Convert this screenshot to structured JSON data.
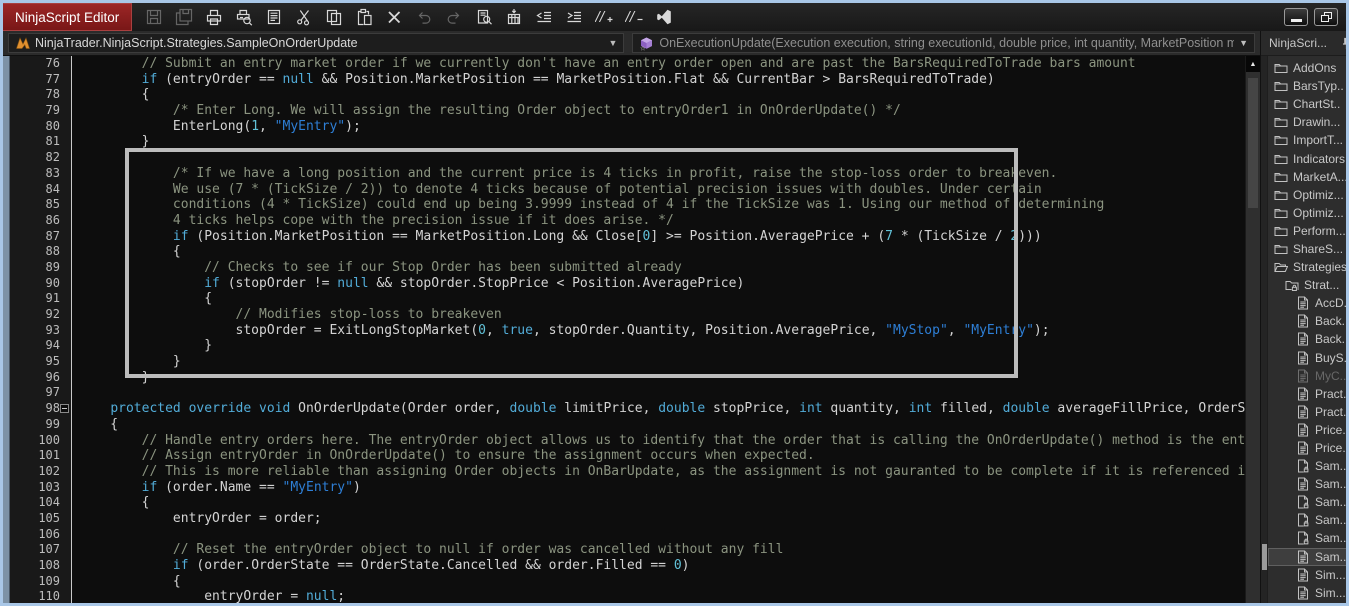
{
  "window": {
    "title": "NinjaScript Editor",
    "controls": [
      {
        "name": "minimize"
      },
      {
        "name": "restore"
      }
    ]
  },
  "colors": {
    "window_border": "#A9C7E7",
    "title_tab_red": "#8E2020",
    "editor_background": "#0D0D0D",
    "gutter_background": "#191919",
    "panel_background": "#2D2D2D",
    "keyword": "#52ACD8",
    "string": "#2E7FD6",
    "number": "#62C2D8",
    "comment": "#8B9480",
    "plain_code": "#D4D4D4",
    "highlight_box_border": "#BCBCBC"
  },
  "toolbar": {
    "buttons": [
      {
        "name": "save",
        "icon": "save",
        "disabled": true
      },
      {
        "name": "save-all",
        "icon": "save-all",
        "disabled": true
      },
      {
        "name": "print",
        "icon": "print",
        "disabled": false
      },
      {
        "name": "print-preview",
        "icon": "print-preview",
        "disabled": false
      },
      {
        "name": "page-setup",
        "icon": "page-setup",
        "disabled": false
      },
      {
        "name": "cut",
        "icon": "cut",
        "disabled": false
      },
      {
        "name": "copy",
        "icon": "copy",
        "disabled": false
      },
      {
        "name": "paste",
        "icon": "paste",
        "disabled": false
      },
      {
        "name": "delete",
        "icon": "delete",
        "disabled": false
      },
      {
        "name": "undo",
        "icon": "undo",
        "disabled": true
      },
      {
        "name": "redo",
        "icon": "redo",
        "disabled": true
      },
      {
        "name": "find",
        "icon": "find",
        "disabled": false
      },
      {
        "name": "compile",
        "icon": "compile",
        "disabled": false
      },
      {
        "name": "unindent",
        "icon": "unindent",
        "disabled": false
      },
      {
        "name": "indent",
        "icon": "indent",
        "disabled": false
      },
      {
        "name": "comment-selection",
        "icon": "comment",
        "disabled": false
      },
      {
        "name": "uncomment-selection",
        "icon": "uncomment",
        "disabled": false
      },
      {
        "name": "edit-in-visual-studio",
        "icon": "visual-studio",
        "disabled": false
      }
    ]
  },
  "combos": {
    "class_selector": {
      "icon": "ninjatrader-logo",
      "value": "NinjaTrader.NinjaScript.Strategies.SampleOnOrderUpdate"
    },
    "method_selector": {
      "icon": "method-cube",
      "value": "OnExecutionUpdate(Execution execution, string executionId, double price, int quantity, MarketPosition m..."
    }
  },
  "editor": {
    "highlight_box": {
      "from_line": 82,
      "to_line": 96
    },
    "lines": [
      {
        "n": 76,
        "tokens": [
          [
            "c",
            "        // Submit an entry market order if we currently don't have an entry order open and are past the BarsRequiredToTrade bars amount"
          ]
        ]
      },
      {
        "n": 77,
        "tokens": [
          [
            "p",
            "        "
          ],
          [
            "k",
            "if"
          ],
          [
            "p",
            " (entryOrder == "
          ],
          [
            "k",
            "null"
          ],
          [
            "p",
            " && Position.MarketPosition == MarketPosition.Flat && CurrentBar > BarsRequiredToTrade)"
          ]
        ]
      },
      {
        "n": 78,
        "tokens": [
          [
            "p",
            "        {"
          ]
        ]
      },
      {
        "n": 79,
        "tokens": [
          [
            "c",
            "            /* Enter Long. We will assign the resulting Order object to entryOrder1 in OnOrderUpdate() */"
          ]
        ]
      },
      {
        "n": 80,
        "tokens": [
          [
            "p",
            "            EnterLong("
          ],
          [
            "n",
            "1"
          ],
          [
            "p",
            ", "
          ],
          [
            "s",
            "\"MyEntry\""
          ],
          [
            "p",
            ");"
          ]
        ]
      },
      {
        "n": 81,
        "tokens": [
          [
            "p",
            "        }"
          ]
        ]
      },
      {
        "n": 82,
        "tokens": []
      },
      {
        "n": 83,
        "tokens": [
          [
            "c",
            "            /* If we have a long position and the current price is 4 ticks in profit, raise the stop-loss order to breakeven."
          ]
        ]
      },
      {
        "n": 84,
        "tokens": [
          [
            "c",
            "            We use (7 * (TickSize / 2)) to denote 4 ticks because of potential precision issues with doubles. Under certain"
          ]
        ]
      },
      {
        "n": 85,
        "tokens": [
          [
            "c",
            "            conditions (4 * TickSize) could end up being 3.9999 instead of 4 if the TickSize was 1. Using our method of determining"
          ]
        ]
      },
      {
        "n": 86,
        "tokens": [
          [
            "c",
            "            4 ticks helps cope with the precision issue if it does arise. */"
          ]
        ]
      },
      {
        "n": 87,
        "tokens": [
          [
            "p",
            "            "
          ],
          [
            "k",
            "if"
          ],
          [
            "p",
            " (Position.MarketPosition == MarketPosition.Long && Close["
          ],
          [
            "n",
            "0"
          ],
          [
            "p",
            "] >= Position.AveragePrice + ("
          ],
          [
            "n",
            "7"
          ],
          [
            "p",
            " * (TickSize / "
          ],
          [
            "n",
            "2"
          ],
          [
            "p",
            ")))"
          ]
        ]
      },
      {
        "n": 88,
        "tokens": [
          [
            "p",
            "            {"
          ]
        ]
      },
      {
        "n": 89,
        "tokens": [
          [
            "c",
            "                // Checks to see if our Stop Order has been submitted already"
          ]
        ]
      },
      {
        "n": 90,
        "tokens": [
          [
            "p",
            "                "
          ],
          [
            "k",
            "if"
          ],
          [
            "p",
            " (stopOrder != "
          ],
          [
            "k",
            "null"
          ],
          [
            "p",
            " && stopOrder.StopPrice < Position.AveragePrice)"
          ]
        ]
      },
      {
        "n": 91,
        "tokens": [
          [
            "p",
            "                {"
          ]
        ]
      },
      {
        "n": 92,
        "tokens": [
          [
            "c",
            "                    // Modifies stop-loss to breakeven"
          ]
        ]
      },
      {
        "n": 93,
        "tokens": [
          [
            "p",
            "                    stopOrder = ExitLongStopMarket("
          ],
          [
            "n",
            "0"
          ],
          [
            "p",
            ", "
          ],
          [
            "k",
            "true"
          ],
          [
            "p",
            ", stopOrder.Quantity, Position.AveragePrice, "
          ],
          [
            "s",
            "\"MyStop\""
          ],
          [
            "p",
            ", "
          ],
          [
            "s",
            "\"MyEntry\""
          ],
          [
            "p",
            ");"
          ]
        ]
      },
      {
        "n": 94,
        "tokens": [
          [
            "p",
            "                }"
          ]
        ]
      },
      {
        "n": 95,
        "tokens": [
          [
            "p",
            "            }"
          ]
        ]
      },
      {
        "n": 96,
        "tokens": [
          [
            "p",
            "        }"
          ]
        ]
      },
      {
        "n": 97,
        "tokens": []
      },
      {
        "n": 98,
        "fold": "collapse",
        "tokens": [
          [
            "p",
            "    "
          ],
          [
            "k",
            "protected"
          ],
          [
            "p",
            " "
          ],
          [
            "k",
            "override"
          ],
          [
            "p",
            " "
          ],
          [
            "k",
            "void"
          ],
          [
            "p",
            " OnOrderUpdate(Order order, "
          ],
          [
            "k",
            "double"
          ],
          [
            "p",
            " limitPrice, "
          ],
          [
            "k",
            "double"
          ],
          [
            "p",
            " stopPrice, "
          ],
          [
            "k",
            "int"
          ],
          [
            "p",
            " quantity, "
          ],
          [
            "k",
            "int"
          ],
          [
            "p",
            " filled, "
          ],
          [
            "k",
            "double"
          ],
          [
            "p",
            " averageFillPrice, OrderState orderSta"
          ]
        ]
      },
      {
        "n": 99,
        "tokens": [
          [
            "p",
            "    {"
          ]
        ]
      },
      {
        "n": 100,
        "tokens": [
          [
            "c",
            "        // Handle entry orders here. The entryOrder object allows us to identify that the order that is calling the OnOrderUpdate() method is the entry order."
          ]
        ]
      },
      {
        "n": 101,
        "tokens": [
          [
            "c",
            "        // Assign entryOrder in OnOrderUpdate() to ensure the assignment occurs when expected."
          ]
        ]
      },
      {
        "n": 102,
        "tokens": [
          [
            "c",
            "        // This is more reliable than assigning Order objects in OnBarUpdate, as the assignment is not gauranted to be complete if it is referenced immediately a"
          ]
        ]
      },
      {
        "n": 103,
        "tokens": [
          [
            "p",
            "        "
          ],
          [
            "k",
            "if"
          ],
          [
            "p",
            " (order.Name == "
          ],
          [
            "s",
            "\"MyEntry\""
          ],
          [
            "p",
            ")"
          ]
        ]
      },
      {
        "n": 104,
        "tokens": [
          [
            "p",
            "        {"
          ]
        ]
      },
      {
        "n": 105,
        "tokens": [
          [
            "p",
            "            entryOrder = order;"
          ]
        ]
      },
      {
        "n": 106,
        "tokens": []
      },
      {
        "n": 107,
        "tokens": [
          [
            "c",
            "            // Reset the entryOrder object to null if order was cancelled without any fill"
          ]
        ]
      },
      {
        "n": 108,
        "tokens": [
          [
            "p",
            "            "
          ],
          [
            "k",
            "if"
          ],
          [
            "p",
            " (order.OrderState == OrderState.Cancelled && order.Filled == "
          ],
          [
            "n",
            "0"
          ],
          [
            "p",
            ")"
          ]
        ]
      },
      {
        "n": 109,
        "tokens": [
          [
            "p",
            "            {"
          ]
        ]
      },
      {
        "n": 110,
        "tokens": [
          [
            "p",
            "                entryOrder = "
          ],
          [
            "k",
            "null"
          ],
          [
            "p",
            ";"
          ]
        ]
      }
    ]
  },
  "explorer": {
    "header": "NinjaScri...",
    "items": [
      {
        "label": "AddOns",
        "type": "folder",
        "depth": 0
      },
      {
        "label": "BarsTyp..",
        "type": "folder",
        "depth": 0
      },
      {
        "label": "ChartSt..",
        "type": "folder",
        "depth": 0
      },
      {
        "label": "Drawin...",
        "type": "folder",
        "depth": 0
      },
      {
        "label": "ImportT...",
        "type": "folder",
        "depth": 0
      },
      {
        "label": "Indicators",
        "type": "folder",
        "depth": 0
      },
      {
        "label": "MarketA...",
        "type": "folder",
        "depth": 0
      },
      {
        "label": "Optimiz...",
        "type": "folder",
        "depth": 0
      },
      {
        "label": "Optimiz...",
        "type": "folder",
        "depth": 0
      },
      {
        "label": "Perform...",
        "type": "folder",
        "depth": 0
      },
      {
        "label": "ShareS...",
        "type": "folder",
        "depth": 0
      },
      {
        "label": "Strategies",
        "type": "folder-open",
        "depth": 0
      },
      {
        "label": "Strat...",
        "type": "folder-lock",
        "depth": 1
      },
      {
        "label": "AccD...",
        "type": "file",
        "depth": 2
      },
      {
        "label": "Back...",
        "type": "file",
        "depth": 2
      },
      {
        "label": "Back...",
        "type": "file",
        "depth": 2
      },
      {
        "label": "BuyS...",
        "type": "file",
        "depth": 2
      },
      {
        "label": "MyC...",
        "type": "file",
        "depth": 2,
        "dim": true
      },
      {
        "label": "Pract...",
        "type": "file",
        "depth": 2
      },
      {
        "label": "Pract...",
        "type": "file",
        "depth": 2
      },
      {
        "label": "Price...",
        "type": "file",
        "depth": 2
      },
      {
        "label": "Price...",
        "type": "file",
        "depth": 2
      },
      {
        "label": "Sam...",
        "type": "file-lock",
        "depth": 2
      },
      {
        "label": "Sam...",
        "type": "file",
        "depth": 2
      },
      {
        "label": "Sam...",
        "type": "file-lock",
        "depth": 2
      },
      {
        "label": "Sam...",
        "type": "file-lock",
        "depth": 2
      },
      {
        "label": "Sam...",
        "type": "file-lock",
        "depth": 2
      },
      {
        "label": "Sam...",
        "type": "file",
        "depth": 2,
        "selected": true
      },
      {
        "label": "Sim...",
        "type": "file",
        "depth": 2
      },
      {
        "label": "Sim...",
        "type": "file",
        "depth": 2
      }
    ]
  }
}
